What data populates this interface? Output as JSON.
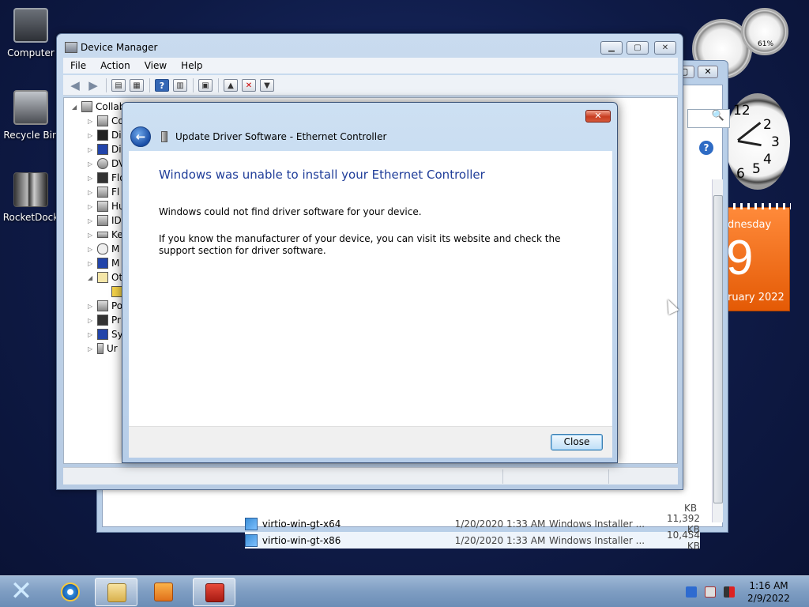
{
  "desktop": {
    "icons": [
      {
        "label": "Computer"
      },
      {
        "label": "Recycle Bin"
      },
      {
        "label": "RocketDock"
      }
    ]
  },
  "gadgets": {
    "meter_label": "61%",
    "clock_numbers": [
      "12",
      "2",
      "3",
      "4",
      "5",
      "6"
    ],
    "calendar": {
      "day": "dnesday",
      "date": "9",
      "month": "ruary 2022"
    }
  },
  "explorer": {
    "search_glyph": "🔍",
    "partial_size": "KB",
    "files": [
      {
        "name": "virtio-win-gt-x64",
        "date": "1/20/2020 1:33 AM",
        "type": "Windows Installer ...",
        "size": "11,392 KB"
      },
      {
        "name": "virtio-win-gt-x86",
        "date": "1/20/2020 1:33 AM",
        "type": "Windows Installer ...",
        "size": "10,454 KB"
      }
    ]
  },
  "device_manager": {
    "title": "Device Manager",
    "menu": [
      "File",
      "Action",
      "View",
      "Help"
    ],
    "tree": [
      {
        "label": "Collab",
        "level": 0,
        "expanded": true
      },
      {
        "label": "Co",
        "level": 1
      },
      {
        "label": "Di",
        "level": 1
      },
      {
        "label": "Di",
        "level": 1
      },
      {
        "label": "DV",
        "level": 1
      },
      {
        "label": "Flo",
        "level": 1
      },
      {
        "label": "Fl",
        "level": 1
      },
      {
        "label": "Hu",
        "level": 1
      },
      {
        "label": "ID",
        "level": 1
      },
      {
        "label": "Ke",
        "level": 1
      },
      {
        "label": "M",
        "level": 1
      },
      {
        "label": "M",
        "level": 1
      },
      {
        "label": "Ot",
        "level": 1,
        "expanded": true
      },
      {
        "label": "",
        "level": 2
      },
      {
        "label": "Po",
        "level": 1
      },
      {
        "label": "Pr",
        "level": 1
      },
      {
        "label": "Sy",
        "level": 1
      },
      {
        "label": "Ur",
        "level": 1
      }
    ]
  },
  "dialog": {
    "title": "Update Driver Software - Ethernet Controller",
    "heading": "Windows was unable to install your Ethernet Controller",
    "message1": "Windows could not find driver software for your device.",
    "message2": "If you know the manufacturer of your device, you can visit its website and check the support section for driver software.",
    "close_label": "Close",
    "close_x": "✕"
  },
  "taskbar": {
    "time": "1:16 AM",
    "date": "2/9/2022",
    "start_glyph": "✕"
  },
  "colors": {
    "heading_blue": "#1f3d99",
    "desktop": "#0f1d4d",
    "calendar_orange": "#e45a05"
  }
}
